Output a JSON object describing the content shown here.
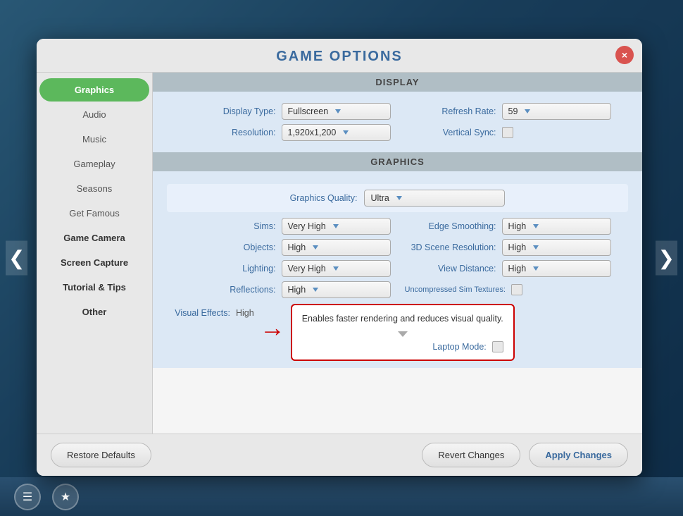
{
  "modal": {
    "title": "Game Options",
    "close_label": "×"
  },
  "sidebar": {
    "items": [
      {
        "id": "graphics",
        "label": "Graphics",
        "active": true,
        "bold": false
      },
      {
        "id": "audio",
        "label": "Audio",
        "active": false,
        "bold": false
      },
      {
        "id": "music",
        "label": "Music",
        "active": false,
        "bold": false
      },
      {
        "id": "gameplay",
        "label": "Gameplay",
        "active": false,
        "bold": false
      },
      {
        "id": "seasons",
        "label": "Seasons",
        "active": false,
        "bold": false
      },
      {
        "id": "get_famous",
        "label": "Get Famous",
        "active": false,
        "bold": false
      },
      {
        "id": "game_camera",
        "label": "Game Camera",
        "active": false,
        "bold": true
      },
      {
        "id": "screen_capture",
        "label": "Screen Capture",
        "active": false,
        "bold": true
      },
      {
        "id": "tutorial_tips",
        "label": "Tutorial & Tips",
        "active": false,
        "bold": true
      },
      {
        "id": "other",
        "label": "Other",
        "active": false,
        "bold": true
      }
    ]
  },
  "sections": {
    "display": {
      "header": "Display",
      "display_type_label": "Display Type:",
      "display_type_value": "Fullscreen",
      "refresh_rate_label": "Refresh Rate:",
      "refresh_rate_value": "59",
      "resolution_label": "Resolution:",
      "resolution_value": "1,920x1,200",
      "vertical_sync_label": "Vertical Sync:"
    },
    "graphics": {
      "header": "Graphics",
      "quality_label": "Graphics Quality:",
      "quality_value": "Ultra",
      "sims_label": "Sims:",
      "sims_value": "Very High",
      "edge_smoothing_label": "Edge Smoothing:",
      "edge_smoothing_value": "High",
      "objects_label": "Objects:",
      "objects_value": "High",
      "scene_res_label": "3D Scene Resolution:",
      "scene_res_value": "High",
      "lighting_label": "Lighting:",
      "lighting_value": "Very High",
      "view_distance_label": "View Distance:",
      "view_distance_value": "High",
      "reflections_label": "Reflections:",
      "reflections_value": "High",
      "uncompressed_label": "Uncompressed Sim Textures:",
      "visual_effects_label": "Visual Effects:",
      "visual_effects_value": "High",
      "laptop_mode_label": "Laptop Mode:"
    }
  },
  "tooltip": {
    "text": "Enables faster rendering and reduces visual quality."
  },
  "footer": {
    "restore_defaults": "Restore Defaults",
    "revert_changes": "Revert Changes",
    "apply_changes": "Apply Changes"
  }
}
